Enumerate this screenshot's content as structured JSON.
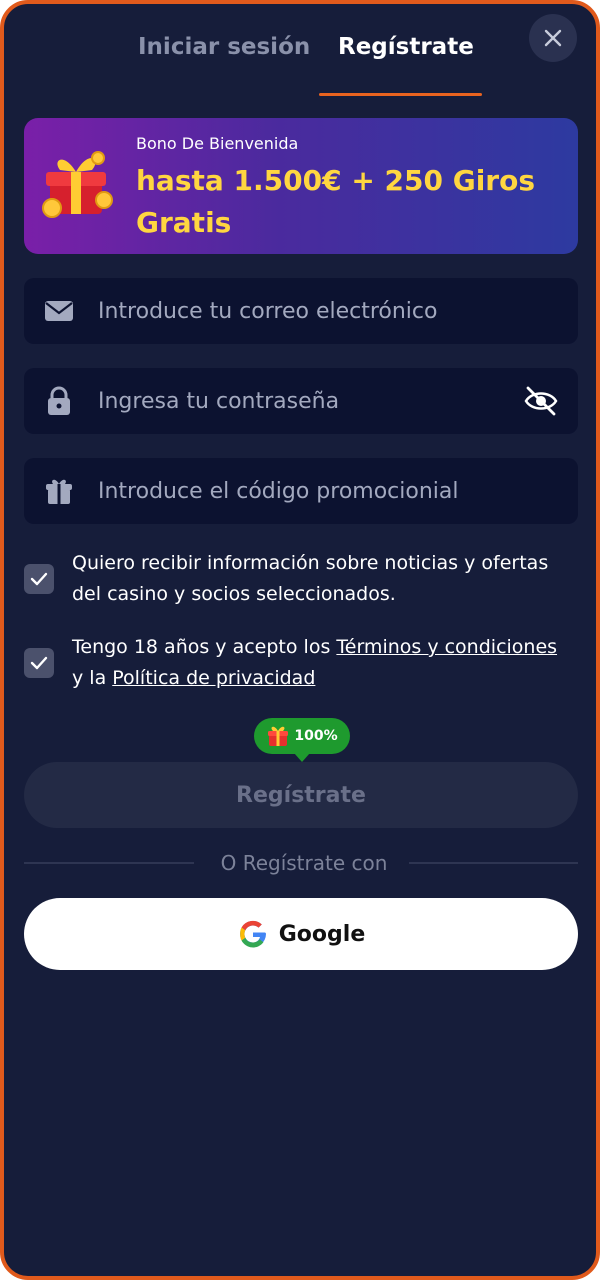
{
  "tabs": {
    "login": "Iniciar sesión",
    "register": "Regístrate"
  },
  "banner": {
    "subtitle": "Bono De Bienvenida",
    "title": "hasta 1.500€ + 250 Giros Gratis"
  },
  "form": {
    "email_placeholder": "Introduce tu correo electrónico",
    "password_placeholder": "Ingresa tu contraseña",
    "promo_placeholder": "Introduce el código promocionial"
  },
  "consent": {
    "newsletter": "Quiero recibir información sobre noticias y ofertas del casino y socios seleccionados.",
    "age_prefix": "Tengo 18 años y acepto los ",
    "terms_link": "Términos y condiciones",
    "age_middle": " y la ",
    "privacy_link": "Política de privacidad"
  },
  "badge": {
    "percent": "100%"
  },
  "submit": {
    "label": "Regístrate"
  },
  "divider": {
    "text": "O Regístrate con"
  },
  "social": {
    "google_label": "Google"
  },
  "colors": {
    "accent": "#e8631f",
    "background": "#161d3a",
    "field": "#0c1230",
    "badge": "#1e9a2e",
    "banner_text": "#ffd640"
  }
}
